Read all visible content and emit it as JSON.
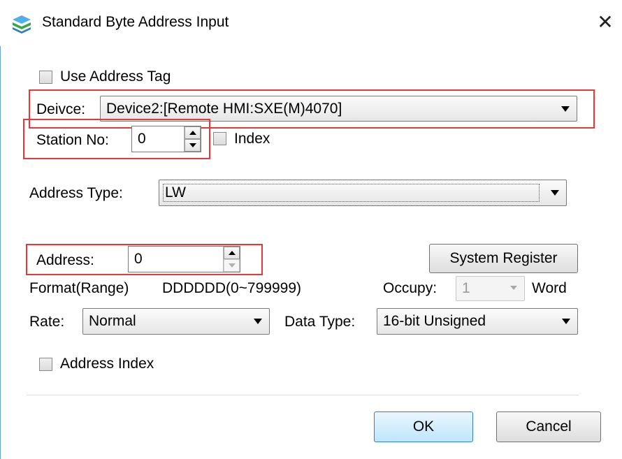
{
  "window": {
    "title": "Standard Byte Address Input",
    "close_glyph": "✕"
  },
  "use_address_tag": {
    "label": "Use Address Tag",
    "checked": false
  },
  "device": {
    "label": "Deivce:",
    "value": "Device2:[Remote HMI:SXE(M)4070]"
  },
  "station": {
    "label": "Station No:",
    "value": "0"
  },
  "index": {
    "label": "Index",
    "checked": false
  },
  "address_type": {
    "label": "Address Type:",
    "value": "LW"
  },
  "address": {
    "label": "Address:",
    "value": "0"
  },
  "system_register_button": "System Register",
  "format": {
    "label": "Format(Range)",
    "value": "DDDDDD(0~799999)"
  },
  "occupy": {
    "label": "Occupy:",
    "value": "1",
    "unit": "Word"
  },
  "rate": {
    "label": "Rate:",
    "value": "Normal"
  },
  "data_type": {
    "label": "Data Type:",
    "value": "16-bit Unsigned"
  },
  "address_index": {
    "label": "Address Index",
    "checked": false
  },
  "buttons": {
    "ok": "OK",
    "cancel": "Cancel"
  },
  "icons": {
    "app": "app-icon",
    "close": "close-icon"
  },
  "colors": {
    "highlight": "#e63a3a",
    "default_button": "#bee6fd",
    "frame": "#6fa3d8"
  }
}
